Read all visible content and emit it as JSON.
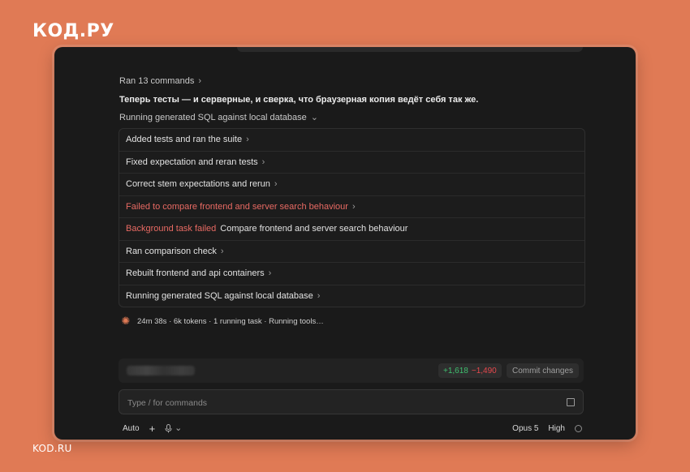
{
  "branding": {
    "logo_top": "КОД.РУ",
    "logo_bottom": "KOD.RU"
  },
  "conversation": {
    "ran_commands": "Ran 13 commands",
    "message": "Теперь тесты — и серверные, и сверка, что браузерная копия ведёт себя так же.",
    "running_header": "Running generated SQL against local database"
  },
  "tasks": [
    {
      "label": "Added tests and ran the suite",
      "status": "ok"
    },
    {
      "label": "Fixed expectation and reran tests",
      "status": "ok"
    },
    {
      "label": "Correct stem expectations and rerun",
      "status": "ok"
    },
    {
      "label": "Failed to compare frontend and server search behaviour",
      "status": "error"
    },
    {
      "prefix": "Background task failed",
      "label": "Compare frontend and server search behaviour",
      "status": "error-prefix"
    },
    {
      "label": "Ran comparison check",
      "status": "ok"
    },
    {
      "label": "Rebuilt frontend and api containers",
      "status": "ok"
    },
    {
      "label": "Running generated SQL against local database",
      "status": "ok"
    }
  ],
  "status": {
    "text": "24m 38s · 6k tokens · 1 running task · Running tools…",
    "icon": "spark-icon"
  },
  "changes": {
    "additions": "+1,618",
    "deletions": "−1,490",
    "commit_label": "Commit changes"
  },
  "input": {
    "placeholder": "Type / for commands",
    "value": ""
  },
  "toolbar": {
    "mode": "Auto",
    "model": "Opus 5",
    "effort": "High"
  },
  "colors": {
    "background": "#e07a55",
    "panel": "#1a1a1a",
    "error": "#e86a63",
    "add": "#3fbf6f",
    "delete": "#e5484d"
  }
}
